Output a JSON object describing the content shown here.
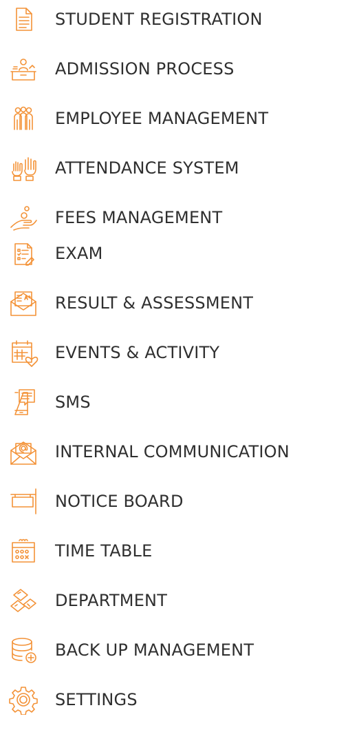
{
  "theme": {
    "accent": "#F39237",
    "text": "#2f2f2f",
    "background": "#ffffff"
  },
  "menu": {
    "items": [
      {
        "label": "STUDENT REGISTRATION",
        "icon": "registration-form-icon"
      },
      {
        "label": "ADMISSION PROCESS",
        "icon": "admission-desk-icon"
      },
      {
        "label": "EMPLOYEE MANAGEMENT",
        "icon": "employees-group-icon"
      },
      {
        "label": "ATTENDANCE SYSTEM",
        "icon": "raised-hands-icon"
      },
      {
        "label": "FEES MANAGEMENT",
        "icon": "hand-coin-icon"
      },
      {
        "label": "EXAM",
        "icon": "exam-paper-icon"
      },
      {
        "label": "RESULT & ASSESSMENT",
        "icon": "result-envelope-icon"
      },
      {
        "label": "EVENTS & ACTIVITY",
        "icon": "event-calendar-icon"
      },
      {
        "label": "SMS",
        "icon": "sms-phone-icon"
      },
      {
        "label": "INTERNAL COMMUNICATION",
        "icon": "email-envelope-icon"
      },
      {
        "label": "NOTICE BOARD",
        "icon": "notice-board-icon"
      },
      {
        "label": "TIME TABLE",
        "icon": "timetable-calendar-icon"
      },
      {
        "label": "DEPARTMENT",
        "icon": "department-blocks-icon"
      },
      {
        "label": "BACK UP MANAGEMENT",
        "icon": "database-backup-icon"
      },
      {
        "label": "SETTINGS",
        "icon": "gear-icon"
      }
    ]
  }
}
